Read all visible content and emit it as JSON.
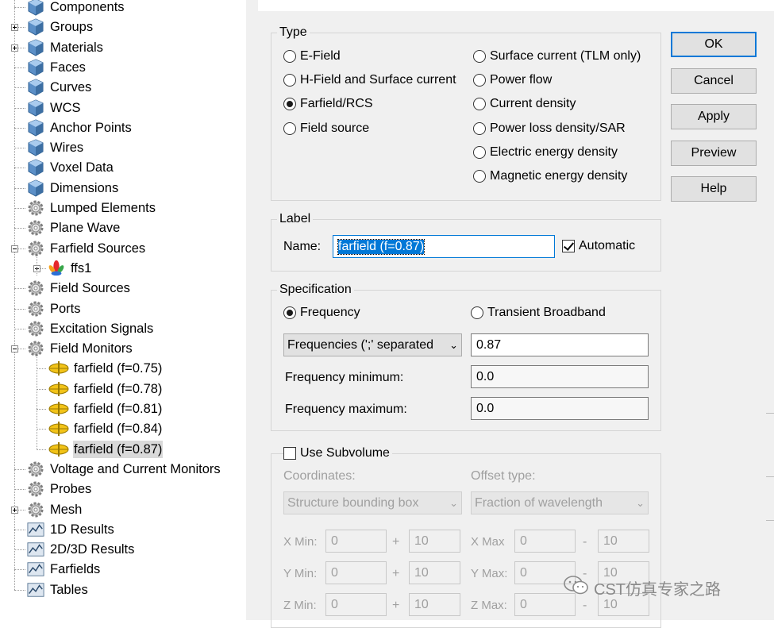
{
  "tree": {
    "items": [
      {
        "label": "Components",
        "icon": "cube-icon",
        "expander": ""
      },
      {
        "label": "Groups",
        "icon": "cube-icon",
        "expander": "plus"
      },
      {
        "label": "Materials",
        "icon": "cube-icon",
        "expander": "plus"
      },
      {
        "label": "Faces",
        "icon": "cube-icon",
        "expander": ""
      },
      {
        "label": "Curves",
        "icon": "cube-icon",
        "expander": ""
      },
      {
        "label": "WCS",
        "icon": "cube-icon",
        "expander": ""
      },
      {
        "label": "Anchor Points",
        "icon": "cube-icon",
        "expander": ""
      },
      {
        "label": "Wires",
        "icon": "cube-icon",
        "expander": ""
      },
      {
        "label": "Voxel Data",
        "icon": "cube-icon",
        "expander": ""
      },
      {
        "label": "Dimensions",
        "icon": "cube-icon",
        "expander": ""
      },
      {
        "label": "Lumped Elements",
        "icon": "gear-icon",
        "expander": ""
      },
      {
        "label": "Plane Wave",
        "icon": "gear-icon",
        "expander": ""
      },
      {
        "label": "Farfield Sources",
        "icon": "gear-icon",
        "expander": "minus"
      },
      {
        "label": "ffs1",
        "icon": "farfield-pattern-icon",
        "expander": "plus",
        "child": true
      },
      {
        "label": "Field Sources",
        "icon": "gear-icon",
        "expander": ""
      },
      {
        "label": "Ports",
        "icon": "gear-icon",
        "expander": ""
      },
      {
        "label": "Excitation Signals",
        "icon": "gear-icon",
        "expander": ""
      },
      {
        "label": "Field Monitors",
        "icon": "gear-icon",
        "expander": "minus"
      },
      {
        "label": "farfield (f=0.75)",
        "icon": "field-monitor-icon",
        "expander": "",
        "child": true
      },
      {
        "label": "farfield (f=0.78)",
        "icon": "field-monitor-icon",
        "expander": "",
        "child": true
      },
      {
        "label": "farfield (f=0.81)",
        "icon": "field-monitor-icon",
        "expander": "",
        "child": true
      },
      {
        "label": "farfield (f=0.84)",
        "icon": "field-monitor-icon",
        "expander": "",
        "child": true
      },
      {
        "label": "farfield (f=0.87)",
        "icon": "field-monitor-icon",
        "expander": "",
        "child": true,
        "selected": true
      },
      {
        "label": "Voltage and Current Monitors",
        "icon": "gear-icon",
        "expander": ""
      },
      {
        "label": "Probes",
        "icon": "gear-icon",
        "expander": ""
      },
      {
        "label": "Mesh",
        "icon": "gear-icon",
        "expander": "plus"
      },
      {
        "label": "1D Results",
        "icon": "result-plot-icon",
        "expander": ""
      },
      {
        "label": "2D/3D Results",
        "icon": "result-plot-icon",
        "expander": ""
      },
      {
        "label": "Farfields",
        "icon": "result-plot-icon",
        "expander": ""
      },
      {
        "label": "Tables",
        "icon": "result-plot-icon",
        "expander": ""
      }
    ]
  },
  "dialog": {
    "type_group": {
      "title": "Type",
      "left_options": [
        "E-Field",
        "H-Field and Surface current",
        "Farfield/RCS",
        "Field source"
      ],
      "right_options": [
        "Surface current (TLM only)",
        "Power flow",
        "Current density",
        "Power loss density/SAR",
        "Electric energy density",
        "Magnetic energy density"
      ],
      "selected": "Farfield/RCS"
    },
    "label_group": {
      "title": "Label",
      "name_label": "Name:",
      "name_value": "farfield (f=0.87)",
      "automatic_label": "Automatic",
      "automatic_checked": true
    },
    "spec_group": {
      "title": "Specification",
      "frequency_label": "Frequency",
      "transient_label": "Transient Broadband",
      "selected": "Frequency",
      "freq_mode": "Frequencies (';' separated",
      "freq_value": "0.87",
      "fmin_label": "Frequency minimum:",
      "fmin_value": "0.0",
      "fmax_label": "Frequency maximum:",
      "fmax_value": "0.0"
    },
    "subvolume_group": {
      "title": "Use Subvolume",
      "checked": false,
      "coordinates_label": "Coordinates:",
      "coordinates_value": "Structure bounding box",
      "offset_label": "Offset type:",
      "offset_value": "Fraction of wavelength",
      "rows": [
        {
          "min_label": "X Min:",
          "min_value": "0",
          "min_offset": "10",
          "max_label": "X Max",
          "max_value": "0",
          "max_offset": "10"
        },
        {
          "min_label": "Y Min:",
          "min_value": "0",
          "min_offset": "10",
          "max_label": "Y Max:",
          "max_value": "0",
          "max_offset": "10"
        },
        {
          "min_label": "Z Min:",
          "min_value": "0",
          "min_offset": "10",
          "max_label": "Z Max:",
          "max_value": "0",
          "max_offset": "10"
        }
      ],
      "plus_sign": "+",
      "minus_sign": "-"
    },
    "buttons": {
      "ok": "OK",
      "cancel": "Cancel",
      "apply": "Apply",
      "preview": "Preview",
      "help": "Help"
    }
  },
  "watermark": {
    "text": "CST仿真专家之路",
    "icon": "wechat-icon"
  },
  "colors": {
    "accent": "#0078d7",
    "dialog_bg": "#f0f0f0",
    "selected_row": "#d9d9d9"
  }
}
